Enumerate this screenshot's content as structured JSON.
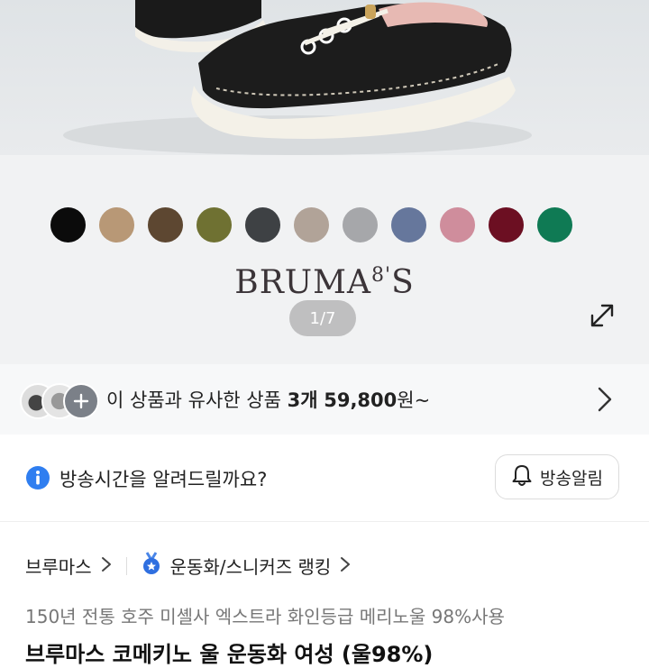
{
  "gallery": {
    "pager": "1/7",
    "brand_logo": "BRUMA",
    "brand_logo_sup": "8'",
    "brand_logo_tail": "S",
    "swatch_colors": [
      "#0b0b0b",
      "#b89876",
      "#5d4731",
      "#6f7132",
      "#3e4144",
      "#b1a398",
      "#a6a7aa",
      "#66779c",
      "#cf8d9c",
      "#6c0f22",
      "#0f7a54"
    ]
  },
  "similar": {
    "prefix": "이 상품과 유사한 상품 ",
    "count": "3개",
    "price": "59,800",
    "suffix": "원~"
  },
  "notify": {
    "text": "방송시간을 알려드릴까요?",
    "button": "방송알림"
  },
  "breadcrumb": {
    "brand": "브루마스",
    "ranking": "운동화/스니커즈 랭킹"
  },
  "product": {
    "subtitle": "150년 전통 호주 미셸사 엑스트라 화인등급 메리노울 98%사용",
    "title": "브루마스 코메키노 울 운동화 여성 (울98%)"
  }
}
